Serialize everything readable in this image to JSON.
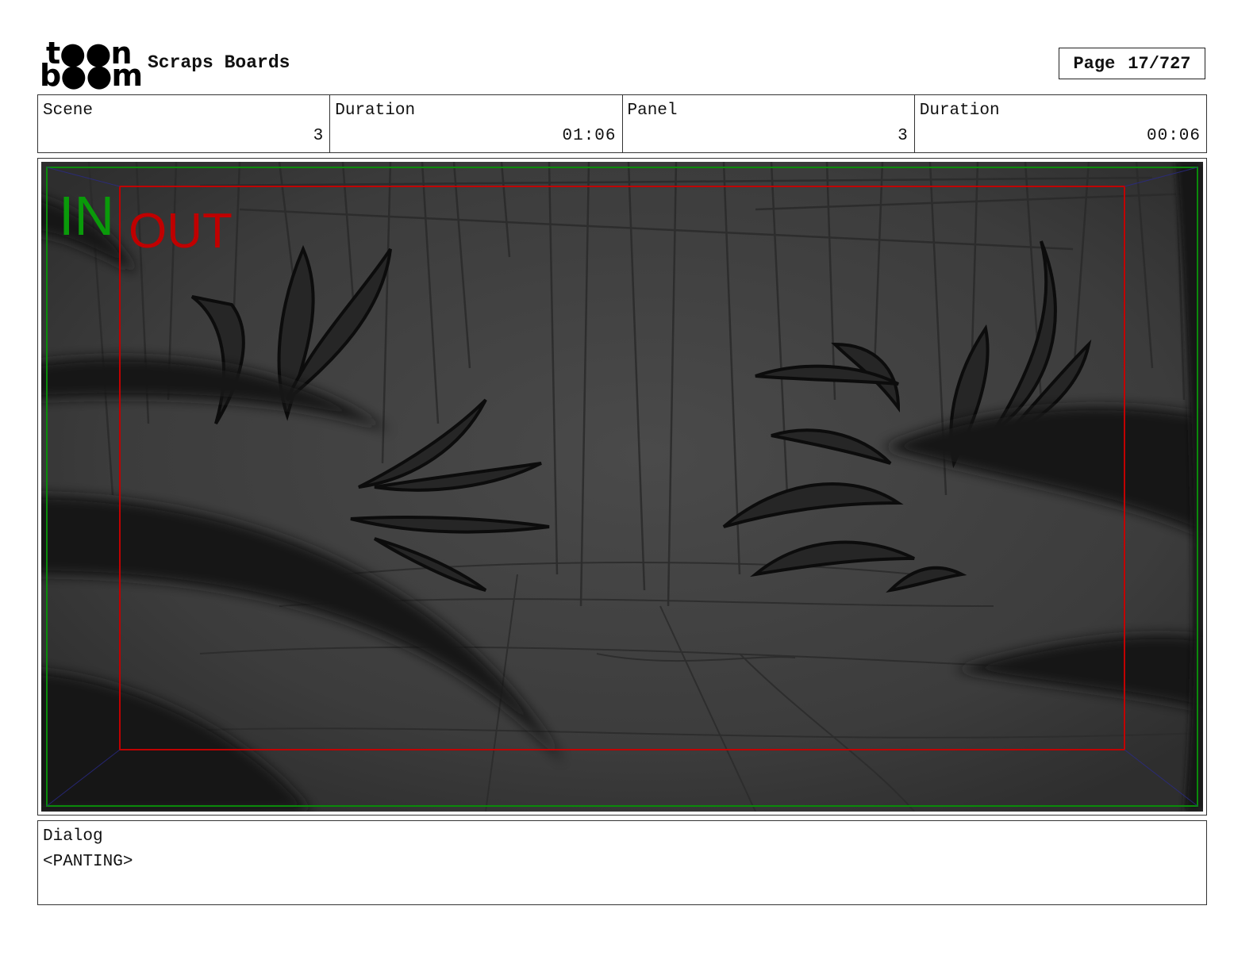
{
  "logo": {
    "line1": "t●●n",
    "line2": "b●●m",
    "brand": "toon boom"
  },
  "header": {
    "title": "Scraps Boards",
    "page_label": "Page",
    "page_value": "17/727"
  },
  "info": {
    "scene_label": "Scene",
    "scene_value": "3",
    "scene_duration_label": "Duration",
    "scene_duration_value": "01:06",
    "panel_label": "Panel",
    "panel_value": "3",
    "panel_duration_label": "Duration",
    "panel_duration_value": "00:06"
  },
  "panel": {
    "in_label": "IN",
    "out_label": "OUT",
    "in_color": "#0a9a0a",
    "out_color": "#c00000"
  },
  "dialog": {
    "label": "Dialog",
    "text": "<PANTING>"
  }
}
